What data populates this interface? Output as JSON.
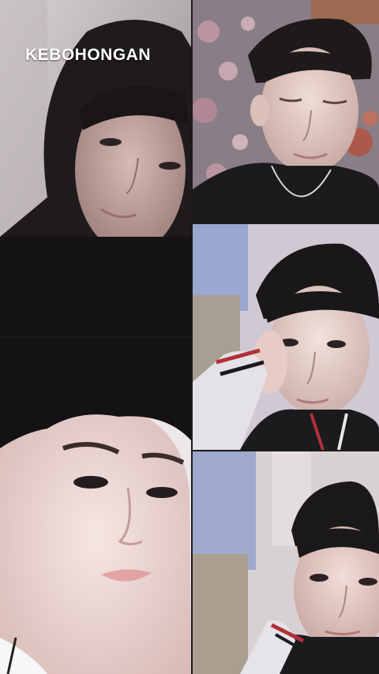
{
  "overlay": {
    "title": "KEBOHONGAN"
  },
  "photos": [
    {
      "name": "hooded-portrait",
      "position": "left-top"
    },
    {
      "name": "eyes-closed-portrait",
      "position": "right-top"
    },
    {
      "name": "hand-on-cheek-portrait",
      "position": "right-middle"
    },
    {
      "name": "closeup-face-portrait",
      "position": "left-bottom"
    },
    {
      "name": "low-angle-portrait",
      "position": "right-bottom"
    }
  ]
}
